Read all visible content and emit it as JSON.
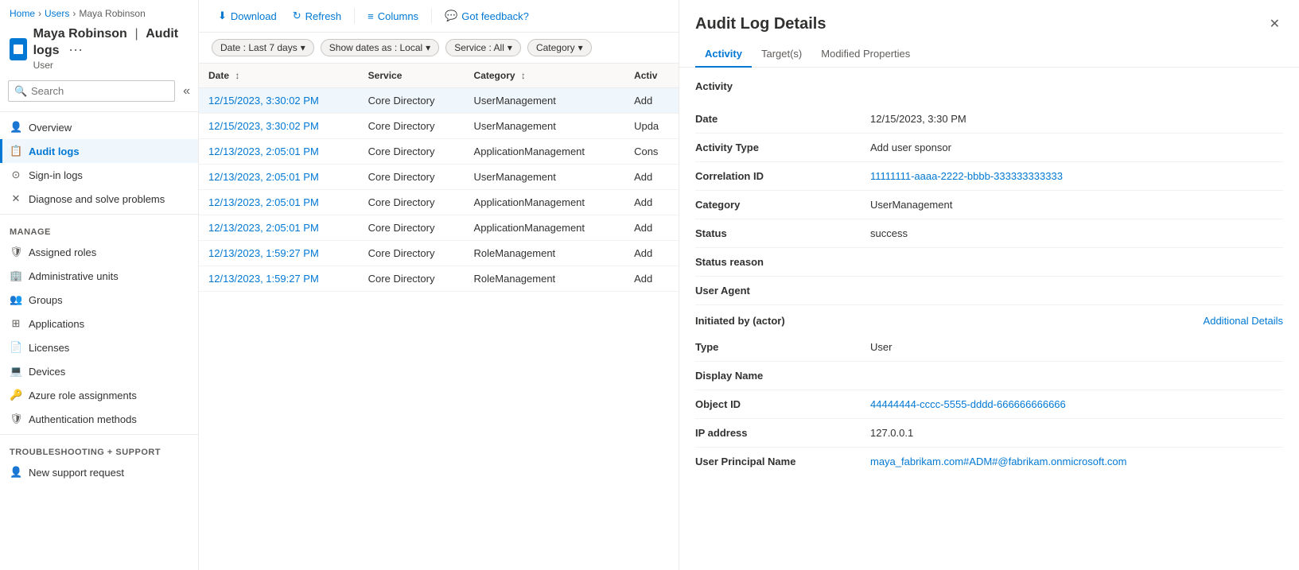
{
  "breadcrumb": {
    "items": [
      "Home",
      "Users",
      "Maya Robinson"
    ]
  },
  "page": {
    "icon_label": "user-page-icon",
    "title": "Maya Robinson",
    "pipe": "|",
    "subtitle_label": "Audit logs",
    "user_type": "User"
  },
  "sidebar": {
    "search_placeholder": "Search",
    "collapse_icon": "«",
    "nav_items": [
      {
        "id": "overview",
        "label": "Overview",
        "icon": "person"
      },
      {
        "id": "audit-logs",
        "label": "Audit logs",
        "icon": "list",
        "active": true
      },
      {
        "id": "sign-in-logs",
        "label": "Sign-in logs",
        "icon": "clock"
      },
      {
        "id": "diagnose",
        "label": "Diagnose and solve problems",
        "icon": "wrench"
      }
    ],
    "manage_label": "Manage",
    "manage_items": [
      {
        "id": "assigned-roles",
        "label": "Assigned roles",
        "icon": "shield"
      },
      {
        "id": "admin-units",
        "label": "Administrative units",
        "icon": "building"
      },
      {
        "id": "groups",
        "label": "Groups",
        "icon": "group"
      },
      {
        "id": "applications",
        "label": "Applications",
        "icon": "grid"
      },
      {
        "id": "licenses",
        "label": "Licenses",
        "icon": "license"
      },
      {
        "id": "devices",
        "label": "Devices",
        "icon": "device"
      },
      {
        "id": "azure-role",
        "label": "Azure role assignments",
        "icon": "key"
      },
      {
        "id": "auth-methods",
        "label": "Authentication methods",
        "icon": "shield-check"
      }
    ],
    "troubleshoot_label": "Troubleshooting + Support",
    "troubleshoot_items": [
      {
        "id": "new-support",
        "label": "New support request",
        "icon": "person-help"
      }
    ]
  },
  "toolbar": {
    "download_label": "Download",
    "refresh_label": "Refresh",
    "columns_label": "Columns",
    "feedback_label": "Got feedback?"
  },
  "filters": {
    "date_filter": "Date : Last 7 days",
    "show_dates": "Show dates as : Local",
    "service_filter": "Service : All",
    "category_filter": "Category"
  },
  "table": {
    "columns": [
      "Date",
      "Service",
      "Category",
      "Activ"
    ],
    "rows": [
      {
        "date": "12/15/2023, 3:30:02 PM",
        "service": "Core Directory",
        "category": "UserManagement",
        "activity": "Add"
      },
      {
        "date": "12/15/2023, 3:30:02 PM",
        "service": "Core Directory",
        "category": "UserManagement",
        "activity": "Upda"
      },
      {
        "date": "12/13/2023, 2:05:01 PM",
        "service": "Core Directory",
        "category": "ApplicationManagement",
        "activity": "Cons"
      },
      {
        "date": "12/13/2023, 2:05:01 PM",
        "service": "Core Directory",
        "category": "UserManagement",
        "activity": "Add"
      },
      {
        "date": "12/13/2023, 2:05:01 PM",
        "service": "Core Directory",
        "category": "ApplicationManagement",
        "activity": "Add"
      },
      {
        "date": "12/13/2023, 2:05:01 PM",
        "service": "Core Directory",
        "category": "ApplicationManagement",
        "activity": "Add"
      },
      {
        "date": "12/13/2023, 1:59:27 PM",
        "service": "Core Directory",
        "category": "RoleManagement",
        "activity": "Add"
      },
      {
        "date": "12/13/2023, 1:59:27 PM",
        "service": "Core Directory",
        "category": "RoleManagement",
        "activity": "Add"
      }
    ]
  },
  "panel": {
    "title": "Audit Log Details",
    "tabs": [
      "Activity",
      "Target(s)",
      "Modified Properties"
    ],
    "active_tab": "Activity",
    "section_title": "Activity",
    "details": [
      {
        "label": "Date",
        "value": "12/15/2023, 3:30 PM",
        "type": "text"
      },
      {
        "label": "Activity Type",
        "value": "Add user sponsor",
        "type": "text"
      },
      {
        "label": "Correlation ID",
        "value": "11111111-aaaa-2222-bbbb-333333333333",
        "type": "id"
      },
      {
        "label": "Category",
        "value": "UserManagement",
        "type": "text"
      },
      {
        "label": "Status",
        "value": "success",
        "type": "text"
      },
      {
        "label": "Status reason",
        "value": "",
        "type": "text"
      },
      {
        "label": "User Agent",
        "value": "",
        "type": "text"
      }
    ],
    "actor_section": "Initiated by (actor)",
    "additional_details_label": "Additional Details",
    "actor_details": [
      {
        "label": "Type",
        "value": "User",
        "type": "text"
      },
      {
        "label": "Display Name",
        "value": "",
        "type": "text"
      },
      {
        "label": "Object ID",
        "value": "44444444-cccc-5555-dddd-666666666666",
        "type": "id"
      },
      {
        "label": "IP address",
        "value": "127.0.0.1",
        "type": "text"
      },
      {
        "label": "User Principal Name",
        "value": "maya_fabrikam.com#ADM#@fabrikam.onmicrosoft.com",
        "type": "link"
      }
    ]
  }
}
